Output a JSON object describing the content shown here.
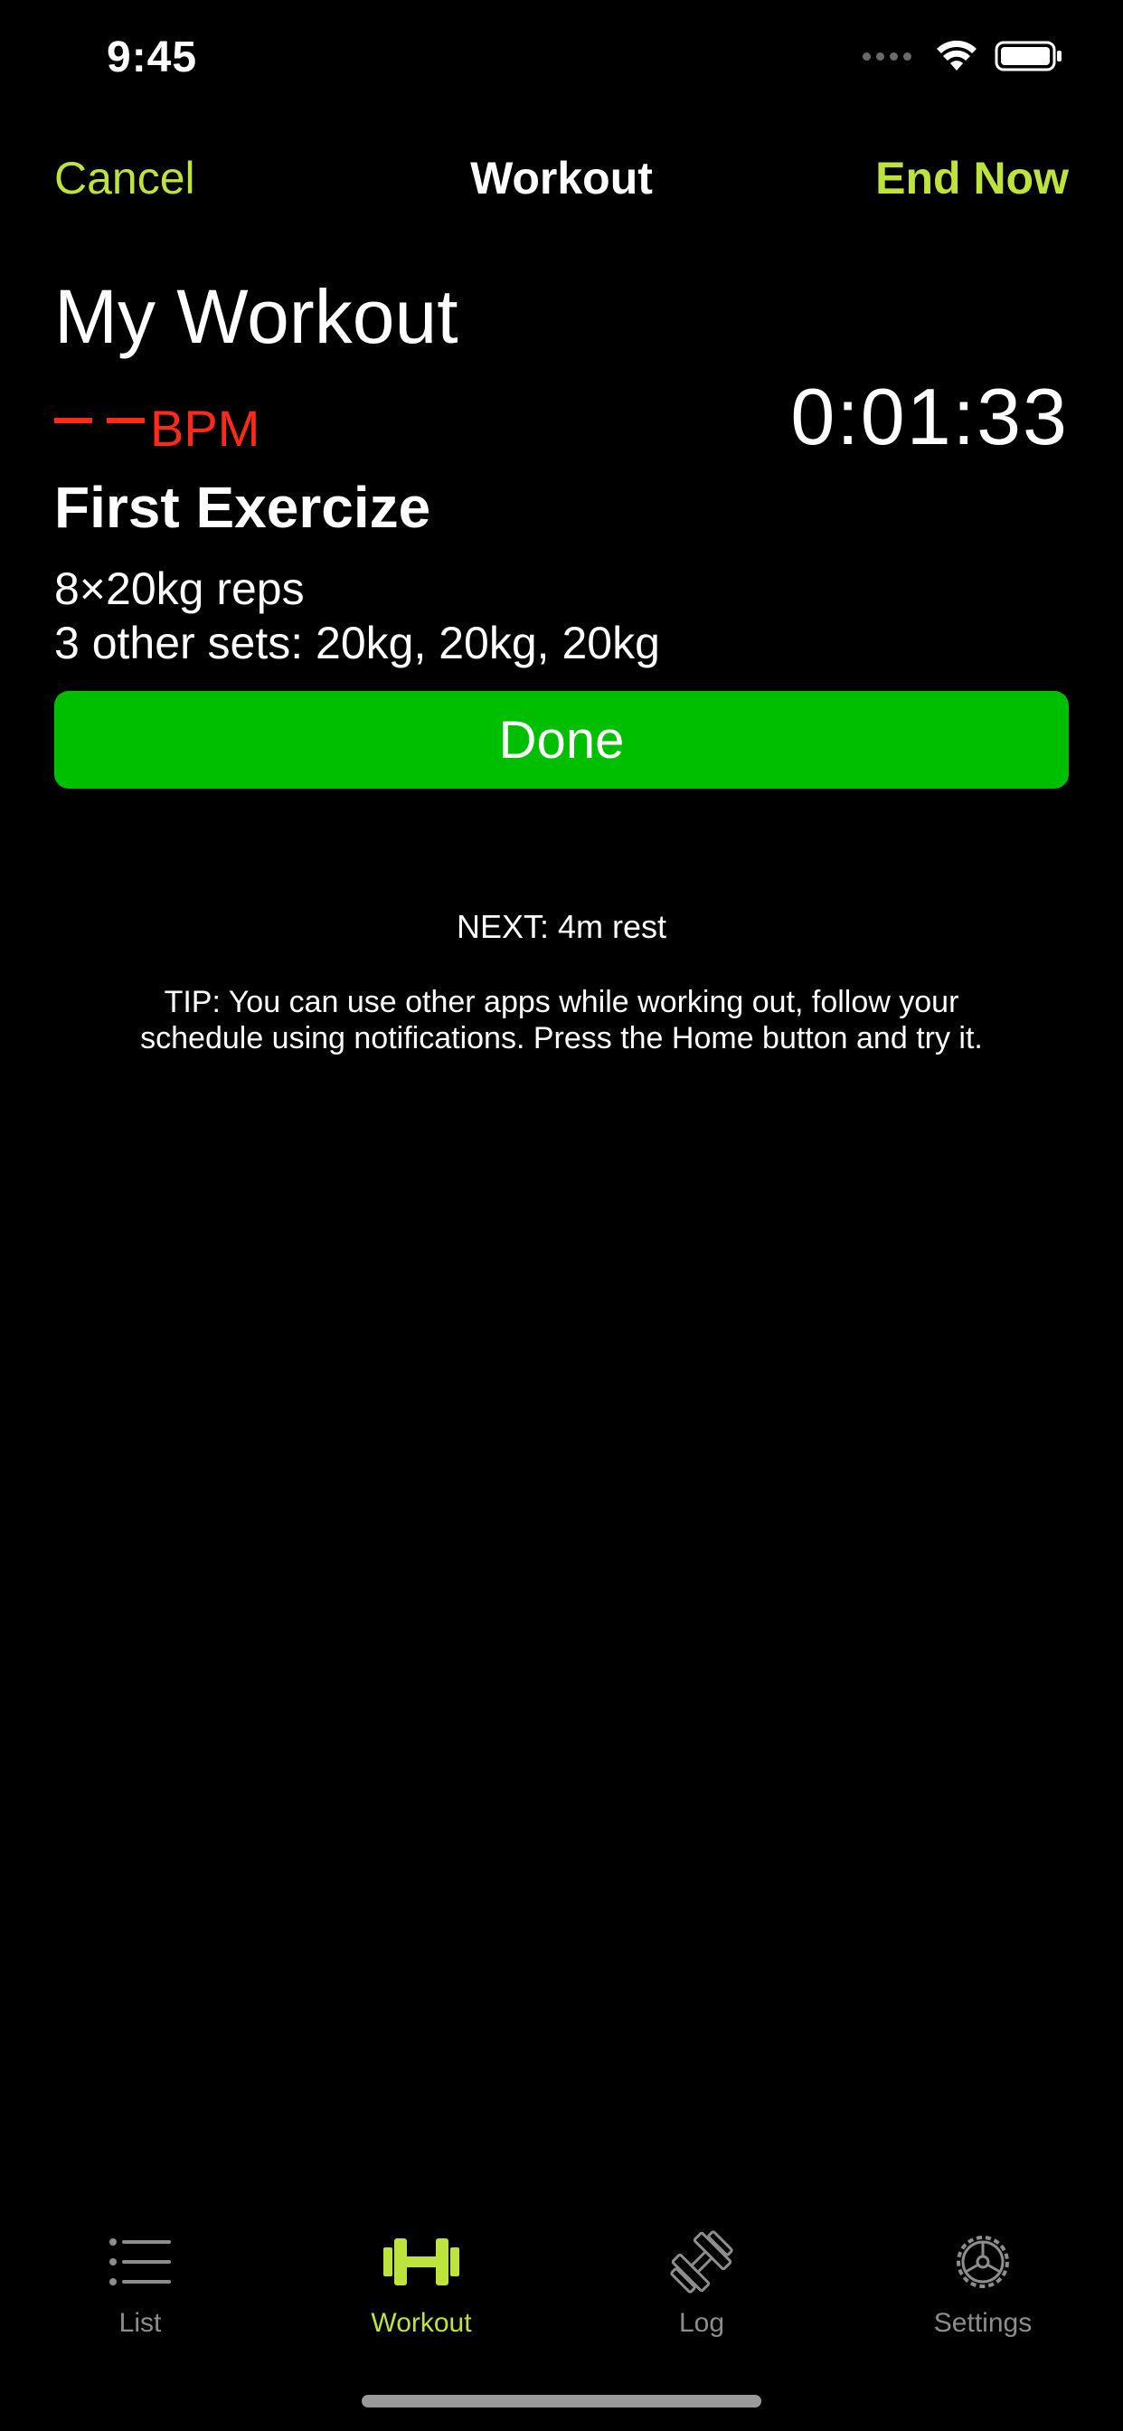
{
  "status_bar": {
    "time": "9:45"
  },
  "navbar": {
    "cancel_label": "Cancel",
    "title": "Workout",
    "end_label": "End Now"
  },
  "workout": {
    "name": "My Workout",
    "bpm_label": "BPM",
    "elapsed": "0:01:33",
    "exercise_name": "First Exercize",
    "reps_line": "8×20kg reps",
    "other_sets_line": "3 other sets: 20kg, 20kg, 20kg",
    "done_label": "Done",
    "next_line": "NEXT: 4m rest",
    "tip_line": "TIP: You can use other apps while working out, follow your schedule using notifications. Press the Home button and try it."
  },
  "tabbar": {
    "tabs": [
      {
        "label": "List",
        "icon": "list-icon",
        "active": false
      },
      {
        "label": "Workout",
        "icon": "dumbbell-icon",
        "active": true
      },
      {
        "label": "Log",
        "icon": "log-icon",
        "active": false
      },
      {
        "label": "Settings",
        "icon": "gear-icon",
        "active": false
      }
    ]
  },
  "colors": {
    "accent": "#bde43c",
    "done": "#00be00",
    "bpm": "#ff2a1a",
    "background": "#000000"
  }
}
